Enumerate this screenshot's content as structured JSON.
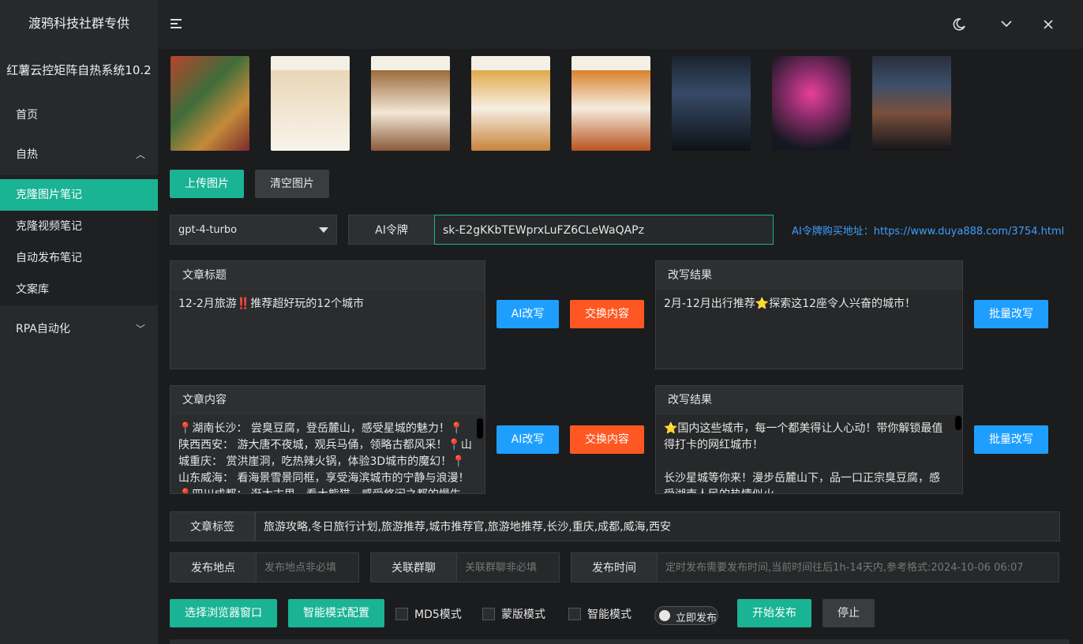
{
  "sidebar": {
    "brand_line1": "渡鸦科技社群专供",
    "brand_line2": "红薯云控矩阵自热系统10.2",
    "items": [
      {
        "label": "首页"
      },
      {
        "label": "自热"
      },
      {
        "label": "克隆图片笔记"
      },
      {
        "label": "克隆视频笔记"
      },
      {
        "label": "自动发布笔记"
      },
      {
        "label": "文案库"
      },
      {
        "label": "RPA自动化"
      }
    ]
  },
  "toolbar": {
    "upload_label": "上传图片",
    "clear_label": "清空图片"
  },
  "model": {
    "selected": "gpt-4-turbo",
    "token_label": "AI令牌",
    "token_value": "sk-E2gKKbTEWprxLuFZ6CLeWaQAPz",
    "buy_prefix": "AI令牌购买地址：",
    "buy_url": "https://www.duya888.com/3754.html"
  },
  "title_panel": {
    "label": "文章标题",
    "value": "12-2月旅游‼️推荐超好玩的12个城市"
  },
  "title_result": {
    "label": "改写结果",
    "value": "2月-12月出行推荐⭐探索这12座令人兴奋的城市！"
  },
  "content_panel": {
    "label": "文章内容",
    "value": "📍湖南长沙： 尝臭豆腐，登岳麓山，感受星城的魅力！📍陕西西安： 游大唐不夜城，观兵马俑，领略古都风采！📍山城重庆： 赏洪崖洞，吃热辣火锅，体验3D城市的魔幻！📍山东威海： 看海景雪景同框，享受海滨城市的宁静与浪漫！📍四川成都： 逛太古里，看大熊猫，感受悠闲之都的慢生"
  },
  "content_result": {
    "label": "改写结果",
    "value": "⭐国内这些城市，每一个都美得让人心动！带你解锁最值得打卡的网红城市！\n\n长沙星城等你来！漫步岳麓山下，品一口正宗臭豆腐，感受湖南人民的热情似火~"
  },
  "buttons": {
    "ai_rewrite": "AI改写",
    "swap": "交换内容",
    "batch_rewrite": "批量改写"
  },
  "tags": {
    "label": "文章标签",
    "value": "旅游攻略,冬日旅行计划,旅游推荐,城市推荐官,旅游地推荐,长沙,重庆,成都,威海,西安"
  },
  "publish": {
    "location_label": "发布地点",
    "location_placeholder": "发布地点非必填",
    "group_label": "关联群聊",
    "group_placeholder": "关联群聊非必填",
    "time_label": "发布时间",
    "time_placeholder": "定时发布需要发布时间,当前时间往后1h-14天内,参考格式:2024-10-06 06:07"
  },
  "bottom": {
    "choose_browser": "选择浏览器窗口",
    "smart_config": "智能模式配置",
    "md5": "MD5模式",
    "template": "蒙版模式",
    "smart": "智能模式",
    "instant": "立即发布",
    "start": "开始发布",
    "stop": "停止"
  },
  "colors": {
    "accent": "#1ab394",
    "blue": "#1e9fff",
    "orange": "#ff5722",
    "link": "#3aa0ff"
  }
}
